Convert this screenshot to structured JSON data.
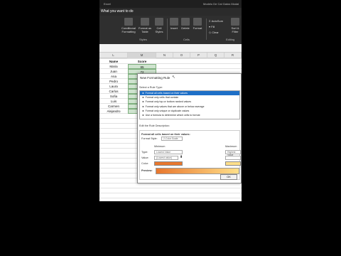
{
  "window": {
    "title": "Excel",
    "file_title": "Modelo De Cal Gatos Modal"
  },
  "tell_me": "What you want to do",
  "ribbon": {
    "buttons": [
      {
        "name": "conditional-formatting",
        "line1": "Conditional",
        "line2": "Formatting"
      },
      {
        "name": "format-as-table",
        "line1": "Format as",
        "line2": "Table"
      },
      {
        "name": "cell-styles",
        "line1": "Cell",
        "line2": "Styles"
      },
      {
        "name": "insert",
        "line1": "Insert",
        "line2": ""
      },
      {
        "name": "delete",
        "line1": "Delete",
        "line2": ""
      },
      {
        "name": "format",
        "line1": "Format",
        "line2": ""
      },
      {
        "name": "sort-filter",
        "line1": "Sort &",
        "line2": "Filter"
      }
    ],
    "editing_items": [
      "AutoSum",
      "Fill",
      "Clear"
    ],
    "groups": {
      "styles": "Styles",
      "cells": "Cells",
      "editing": "Editing"
    }
  },
  "columns": [
    "L",
    "M",
    "N",
    "O",
    "P",
    "Q",
    "R"
  ],
  "sheet": {
    "headers": {
      "name": "Name",
      "score": "Score"
    },
    "rows": [
      {
        "name": "Maria",
        "score": "85"
      },
      {
        "name": "Juan",
        "score": "72"
      },
      {
        "name": "Ana",
        "score": ""
      },
      {
        "name": "Pedro",
        "score": ""
      },
      {
        "name": "Laura",
        "score": ""
      },
      {
        "name": "Carlos",
        "score": ""
      },
      {
        "name": "Sofia",
        "score": ""
      },
      {
        "name": "Luis",
        "score": ""
      },
      {
        "name": "Carmen",
        "score": ""
      },
      {
        "name": "Alejandro",
        "score": ""
      }
    ]
  },
  "dialog": {
    "title": "New Formatting Rule",
    "select_rule_type_label": "Select a Rule Type:",
    "rule_types": [
      "Format all cells based on their values",
      "Format only cells that contain",
      "Format only top or bottom ranked values",
      "Format only values that are above or below average",
      "Format only unique or duplicate values",
      "Use a formula to determine which cells to format"
    ],
    "selected_index": 0,
    "edit_label": "Edit the Rule Description:",
    "format_all_label": "Format all cells based on their values:",
    "format_style_label": "Format Style:",
    "format_style_value": "2-Color Scale",
    "minimum_label": "Minimum",
    "maximum_label": "Maximum",
    "type_label": "Type:",
    "type_min": "Lowest Value",
    "type_max": "Highest Value",
    "value_label": "Value:",
    "value_min": "(Lowest value)",
    "color_label": "Color:",
    "preview_label": "Preview:",
    "ok_label": "OK",
    "min_color": "#e8772e",
    "max_color": "#ffe08a"
  }
}
